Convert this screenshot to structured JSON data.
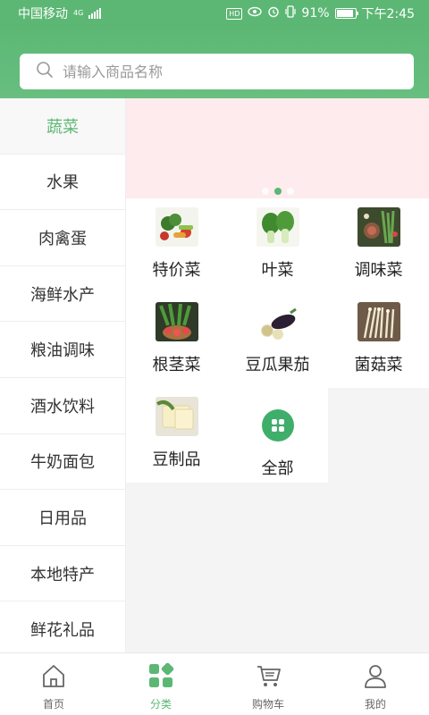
{
  "status_bar": {
    "carrier": "中国移动",
    "network": "4G",
    "battery_percent": "91%",
    "battery_level": 0.91,
    "time": "下午2:45",
    "hd_label": "HD"
  },
  "search": {
    "placeholder": "请输入商品名称",
    "icon": "search-icon"
  },
  "sidebar": {
    "active_index": 0,
    "items": [
      {
        "label": "蔬菜"
      },
      {
        "label": "水果"
      },
      {
        "label": "肉禽蛋"
      },
      {
        "label": "海鲜水产"
      },
      {
        "label": "粮油调味"
      },
      {
        "label": "酒水饮料"
      },
      {
        "label": "牛奶面包"
      },
      {
        "label": "日用品"
      },
      {
        "label": "本地特产"
      },
      {
        "label": "鲜花礼品"
      }
    ]
  },
  "banner": {
    "dot_count": 3,
    "active_dot": 1
  },
  "categories": [
    {
      "label": "特价菜",
      "image": "mixed-vegetables"
    },
    {
      "label": "叶菜",
      "image": "bok-choy"
    },
    {
      "label": "调味菜",
      "image": "herbs-and-spices"
    },
    {
      "label": "根茎菜",
      "image": "radishes"
    },
    {
      "label": "豆瓜果茄",
      "image": "eggplant"
    },
    {
      "label": "菌菇菜",
      "image": "enoki-mushrooms"
    },
    {
      "label": "豆制品",
      "image": "tofu"
    },
    {
      "label": "全部",
      "image": "grid-icon"
    }
  ],
  "tabbar": {
    "active_index": 1,
    "items": [
      {
        "label": "首页",
        "icon": "home-icon"
      },
      {
        "label": "分类",
        "icon": "category-icon"
      },
      {
        "label": "购物车",
        "icon": "cart-icon"
      },
      {
        "label": "我的",
        "icon": "user-icon"
      }
    ]
  },
  "colors": {
    "brand_green": "#5cb774",
    "banner_pink": "#fdebed",
    "inactive_text": "#666666"
  }
}
